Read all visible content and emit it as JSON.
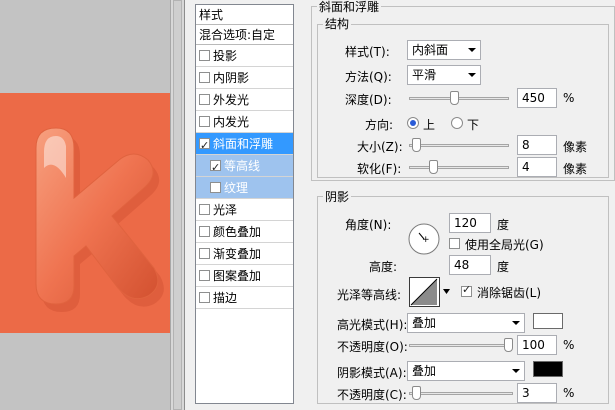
{
  "style_list": {
    "header": "样式",
    "blend_options": "混合选项:自定",
    "items": [
      {
        "label": "投影",
        "checked": false
      },
      {
        "label": "内阴影",
        "checked": false
      },
      {
        "label": "外发光",
        "checked": false
      },
      {
        "label": "内发光",
        "checked": false
      },
      {
        "label": "斜面和浮雕",
        "checked": true
      },
      {
        "label": "等高线",
        "checked": true
      },
      {
        "label": "纹理",
        "checked": false
      },
      {
        "label": "光泽",
        "checked": false
      },
      {
        "label": "颜色叠加",
        "checked": false
      },
      {
        "label": "渐变叠加",
        "checked": false
      },
      {
        "label": "图案叠加",
        "checked": false
      },
      {
        "label": "描边",
        "checked": false
      }
    ]
  },
  "bevel": {
    "title": "斜面和浮雕",
    "structure": {
      "title": "结构",
      "style_label": "样式(T):",
      "style_value": "内斜面",
      "technique_label": "方法(Q):",
      "technique_value": "平滑",
      "depth_label": "深度(D):",
      "depth_value": "450",
      "depth_unit": "%",
      "depth_fraction": 0.45,
      "direction_label": "方向:",
      "direction_up": "上",
      "direction_down": "下",
      "size_label": "大小(Z):",
      "size_value": "8",
      "size_unit": "像素",
      "size_fraction": 0.03,
      "soften_label": "软化(F):",
      "soften_value": "4",
      "soften_unit": "像素",
      "soften_fraction": 0.22
    },
    "shading": {
      "title": "阴影",
      "angle_label": "角度(N):",
      "angle_value": "120",
      "angle_unit": "度",
      "global_light_label": "使用全局光(G)",
      "altitude_label": "高度:",
      "altitude_value": "48",
      "altitude_unit": "度",
      "gloss_contour_label": "光泽等高线:",
      "anti_aliased_label": "消除锯齿(L)",
      "highlight_mode_label": "高光模式(H):",
      "highlight_mode_value": "叠加",
      "highlight_color": "#ffffff",
      "highlight_opacity_label": "不透明度(O):",
      "highlight_opacity_value": "100",
      "highlight_opacity_unit": "%",
      "highlight_opacity_fraction": 1.0,
      "shadow_mode_label": "阴影模式(A):",
      "shadow_mode_value": "叠加",
      "shadow_color": "#000000",
      "shadow_opacity_label": "不透明度(C):",
      "shadow_opacity_value": "3",
      "shadow_opacity_unit": "%",
      "shadow_opacity_fraction": 0.03
    }
  },
  "colors": {
    "canvas_orange": "#ec6a47",
    "list_active": "#3399ff",
    "list_sub": "#9ec3ee"
  }
}
